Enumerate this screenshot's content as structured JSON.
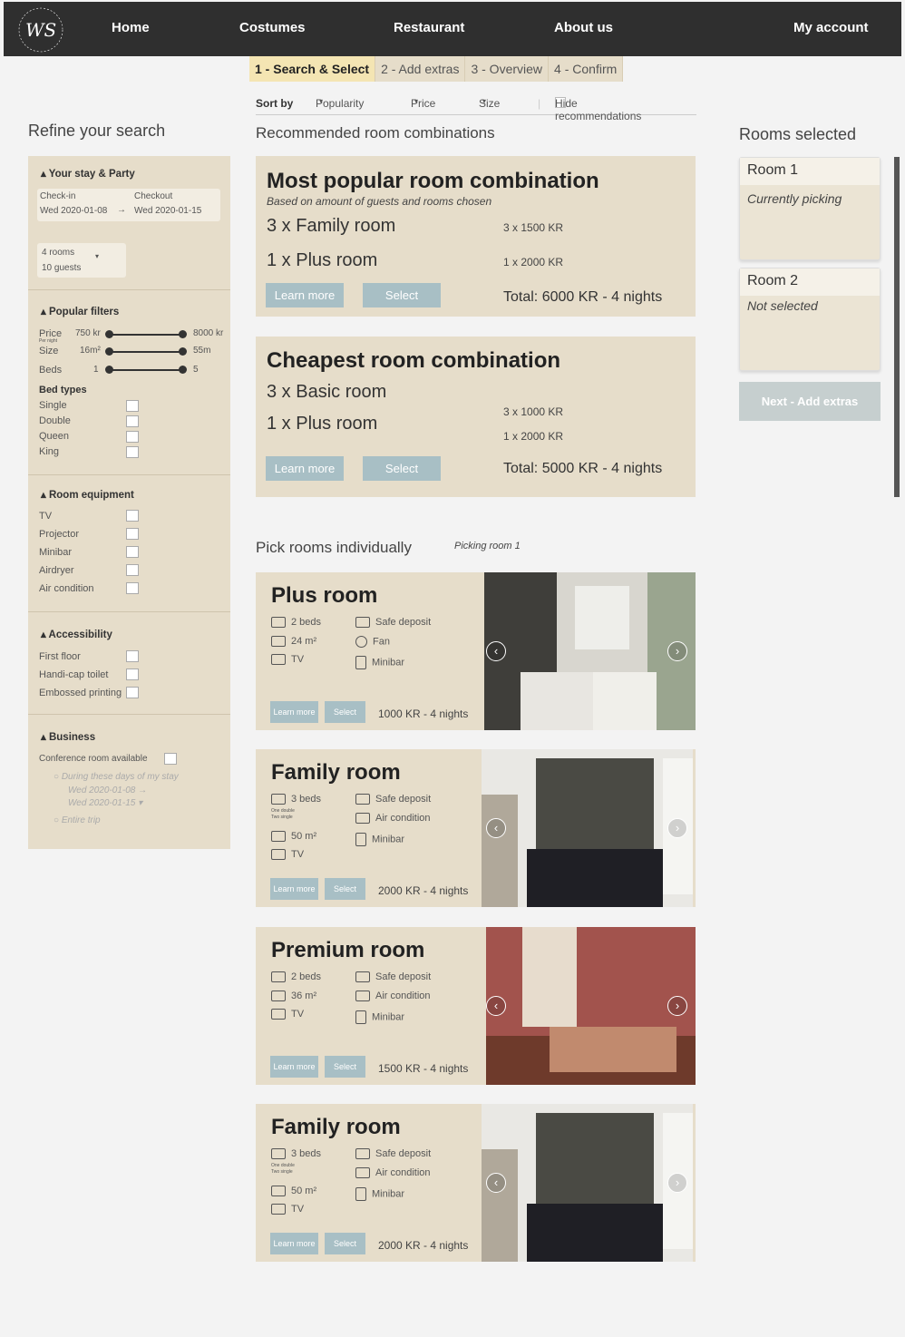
{
  "brand": {
    "logo_text": "WS",
    "logo_ring_top": "WANDHUSET",
    "logo_ring_bottom": "SHOWROOM"
  },
  "nav": {
    "home": "Home",
    "costumes": "Costumes",
    "restaurant": "Restaurant",
    "about": "About us",
    "account": "My account"
  },
  "steps": [
    "1 - Search & Select",
    "2 - Add extras",
    "3 - Overview",
    "4 - Confirm"
  ],
  "sort": {
    "label": "Sort by",
    "popularity": "Popularity",
    "price": "Price",
    "size": "Size",
    "hide": "Hide recommendations"
  },
  "refine": {
    "title": "Refine your search",
    "stay": {
      "title": "Your stay & Party",
      "checkin_label": "Check-in",
      "checkin": "Wed 2020-01-08",
      "checkout_label": "Checkout",
      "checkout": "Wed 2020-01-15",
      "rooms": "4 rooms",
      "guests": "10 guests"
    },
    "popular": {
      "title": "Popular filters",
      "price_label": "Price",
      "price_sub": "Per night",
      "price_min": "750 kr",
      "price_max": "8000 kr",
      "size_label": "Size",
      "size_min": "16m²",
      "size_max": "55m",
      "beds_label": "Beds",
      "beds_min": "1",
      "beds_max": "5",
      "bed_types_label": "Bed types",
      "bed_types": [
        "Single",
        "Double",
        "Queen",
        "King"
      ]
    },
    "equipment": {
      "title": "Room equipment",
      "items": [
        "TV",
        "Projector",
        "Minibar",
        "Airdryer",
        "Air condition"
      ]
    },
    "accessibility": {
      "title": "Accessibility",
      "items": [
        "First floor",
        "Handi-cap toilet",
        "Embossed printing"
      ]
    },
    "business": {
      "title": "Business",
      "conf": "Conference room available",
      "opt1": "During these days of my stay",
      "d1": "Wed 2020-01-08",
      "d2": "Wed 2020-01-15",
      "opt2": "Entire trip"
    }
  },
  "recommended": {
    "heading": "Recommended room combinations",
    "popular": {
      "title": "Most popular room combination",
      "sub": "Based on amount of guests and rooms chosen",
      "line1": "3 x Family room",
      "price1": "3 x 1500 KR",
      "line2": "1 x Plus room",
      "price2": "1 x 2000 KR",
      "learn": "Learn more",
      "select": "Select",
      "total": "Total: 6000 KR - 4 nights"
    },
    "cheap": {
      "title": "Cheapest room combination",
      "line1": "3 x Basic room",
      "price1": "3 x 1000 KR",
      "line2": "1 x Plus room",
      "price2": "1 x 2000 KR",
      "learn": "Learn more",
      "select": "Select",
      "total": "Total: 5000 KR - 4 nights"
    }
  },
  "individual": {
    "heading": "Pick rooms individually",
    "picking": "Picking room 1"
  },
  "rooms": [
    {
      "title": "Plus room",
      "beds": "2 beds",
      "bed_note1": "",
      "bed_note2": "",
      "size": "24 m²",
      "tv": "TV",
      "f1": "Safe deposit",
      "f2": "Fan",
      "f3": "Minibar",
      "learn": "Learn more",
      "select": "Select",
      "price": "1000 KR - 4 nights"
    },
    {
      "title": "Family room",
      "beds": "3 beds",
      "bed_note1": "One double",
      "bed_note2": "Two single",
      "size": "50 m²",
      "tv": "TV",
      "f1": "Safe deposit",
      "f2": "Air condition",
      "f3": "Minibar",
      "learn": "Learn more",
      "select": "Select",
      "price": "2000 KR - 4 nights"
    },
    {
      "title": "Premium room",
      "beds": "2 beds",
      "bed_note1": "",
      "bed_note2": "",
      "size": "36 m²",
      "tv": "TV",
      "f1": "Safe deposit",
      "f2": "Air condition",
      "f3": "Minibar",
      "learn": "Learn more",
      "select": "Select",
      "price": "1500 KR - 4 nights"
    },
    {
      "title": "Family room",
      "beds": "3 beds",
      "bed_note1": "One double",
      "bed_note2": "Two single",
      "size": "50 m²",
      "tv": "TV",
      "f1": "Safe deposit",
      "f2": "Air condition",
      "f3": "Minibar",
      "learn": "Learn more",
      "select": "Select",
      "price": "2000 KR - 4 nights"
    }
  ],
  "selected": {
    "heading": "Rooms selected",
    "room1": {
      "title": "Room 1",
      "status": "Currently picking"
    },
    "room2": {
      "title": "Room 2",
      "status": "Not selected"
    },
    "next": "Next - Add extras"
  },
  "colors": {
    "nav": "#2f2f2f",
    "panel": "#e6ddca",
    "active_step": "#f4e5b3",
    "button": "#a8bfc5",
    "next_button": "#c6cfcf"
  }
}
